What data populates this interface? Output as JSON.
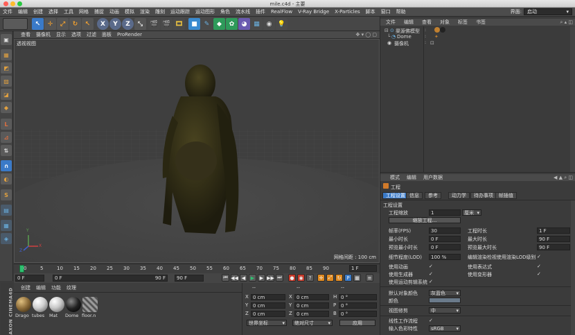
{
  "window": {
    "title": "mile.c4d - 主要"
  },
  "menubar": {
    "items": [
      "文件",
      "编辑",
      "创建",
      "选择",
      "工具",
      "网格",
      "捕捉",
      "动画",
      "模拟",
      "渲染",
      "雕刻",
      "运动跟踪",
      "运动图形",
      "角色",
      "流水线",
      "插件",
      "RealFlow",
      "V-Ray Bridge",
      "X-Particles",
      "脚本",
      "窗口",
      "帮助"
    ],
    "layout_label": "界面:",
    "layout_value": "启动"
  },
  "toolbar": {
    "icons": [
      "undo-icon",
      "redo-icon",
      "live-selection-icon",
      "move-icon",
      "scale-icon",
      "rotate-icon",
      "last-tool-icon",
      "x-axis-icon",
      "y-axis-icon",
      "z-axis-icon",
      "world-coord-icon",
      "render-view-icon",
      "render-picture-viewer-icon",
      "render-settings-icon",
      "cube-icon",
      "pen-icon",
      "subdivision-icon",
      "cloner-icon",
      "deformer-icon",
      "floor-icon",
      "camera-icon",
      "light-icon"
    ],
    "xyz": [
      "X",
      "Y",
      "Z"
    ]
  },
  "viewport": {
    "menu": [
      "查看",
      "摄像机",
      "显示",
      "选项",
      "过滤",
      "面板",
      "ProRender"
    ],
    "label": "透视视图",
    "grid_label": "网格间距 : 100 cm",
    "axis_labels": [
      "Y",
      "X",
      "Z"
    ]
  },
  "timeline": {
    "ticks": [
      "0",
      "5",
      "10",
      "15",
      "20",
      "25",
      "30",
      "35",
      "40",
      "45",
      "50",
      "55",
      "60",
      "65",
      "70",
      "75",
      "80",
      "85",
      "90"
    ],
    "current_frame": "1 F",
    "start_field": "0 F",
    "min_field": "0 F",
    "max_field": "90 F",
    "end_field": "90 F",
    "transport_icons": [
      "go-to-start-icon",
      "prev-key-icon",
      "prev-frame-icon",
      "play-icon",
      "next-frame-icon",
      "next-key-icon",
      "go-to-end-icon",
      "record-icon",
      "auto-key-icon",
      "keyframe-selection-icon",
      "position-key-icon",
      "scale-key-icon",
      "rotation-key-icon",
      "param-key-icon",
      "pla-key-icon",
      "timeline-icon"
    ]
  },
  "material_manager": {
    "menu": [
      "创建",
      "编辑",
      "功能",
      "纹理"
    ],
    "materials": [
      {
        "name": "Drago",
        "color": "#8a6a38"
      },
      {
        "name": "tubes",
        "color": "#cfcfcf"
      },
      {
        "name": "Mat",
        "color": "#c8c8c8"
      },
      {
        "name": "Dome",
        "color": "#222222"
      },
      {
        "name": "floor.n",
        "color": "#777777"
      }
    ],
    "brand": "MAXON CINEMA4D"
  },
  "coordinates": {
    "headers": [
      "--",
      "--",
      "--"
    ],
    "rows": [
      {
        "axis": "X",
        "pos": "0 cm",
        "size": "0 cm",
        "rot_label": "H",
        "rot": "0 °"
      },
      {
        "axis": "Y",
        "pos": "0 cm",
        "size": "0 cm",
        "rot_label": "P",
        "rot": "0 °"
      },
      {
        "axis": "Z",
        "pos": "0 cm",
        "size": "0 cm",
        "rot_label": "B",
        "rot": "0 °"
      }
    ],
    "mode": "世界坐标",
    "scale_mode": "绝对尺寸",
    "apply": "应用"
  },
  "object_manager": {
    "menu": [
      "文件",
      "编辑",
      "查看",
      "对象",
      "标签",
      "书签"
    ],
    "objects": [
      {
        "name": "渠源佛模型"
      },
      {
        "name": "Dome"
      },
      {
        "name": "摄像机"
      }
    ]
  },
  "attributes": {
    "menu": [
      "模式",
      "编辑",
      "用户数据"
    ],
    "title": "工程",
    "tabs": [
      "工程设置",
      "信息",
      "参考",
      "动力学",
      "待办事项",
      "帧插值"
    ],
    "section": "工程设置",
    "project_scale_label": "工程缩放",
    "project_scale_value": "1",
    "project_scale_unit": "厘米",
    "scale_project_button": "缩放工程...",
    "fields_left": [
      {
        "label": "帧率(FPS)",
        "value": "30"
      },
      {
        "label": "最小时长",
        "value": "0 F"
      },
      {
        "label": "预览最小时长",
        "value": "0 F"
      }
    ],
    "fields_right": [
      {
        "label": "工程时长",
        "value": "1 F"
      },
      {
        "label": "最大时长",
        "value": "90 F"
      },
      {
        "label": "预览最大时长",
        "value": "90 F"
      }
    ],
    "lod_label": "细节程度(LOD)",
    "lod_value": "100 %",
    "lod_right": "编辑渲染检视使用渲染LOD级别",
    "checks_left": [
      "使用动画",
      "使用生成器",
      "使用运动剪辑系统"
    ],
    "checks_right": [
      "使用表达式",
      "使用变形器"
    ],
    "default_color_label": "默认对象颜色",
    "default_color_value": "灰蓝色",
    "color_label": "颜色",
    "view_clip_label": "视图修剪",
    "view_clip_value": "中",
    "linear_workflow_label": "线性工作流程",
    "input_color_label": "输入色彩特性",
    "input_color_value": "sRGB"
  }
}
